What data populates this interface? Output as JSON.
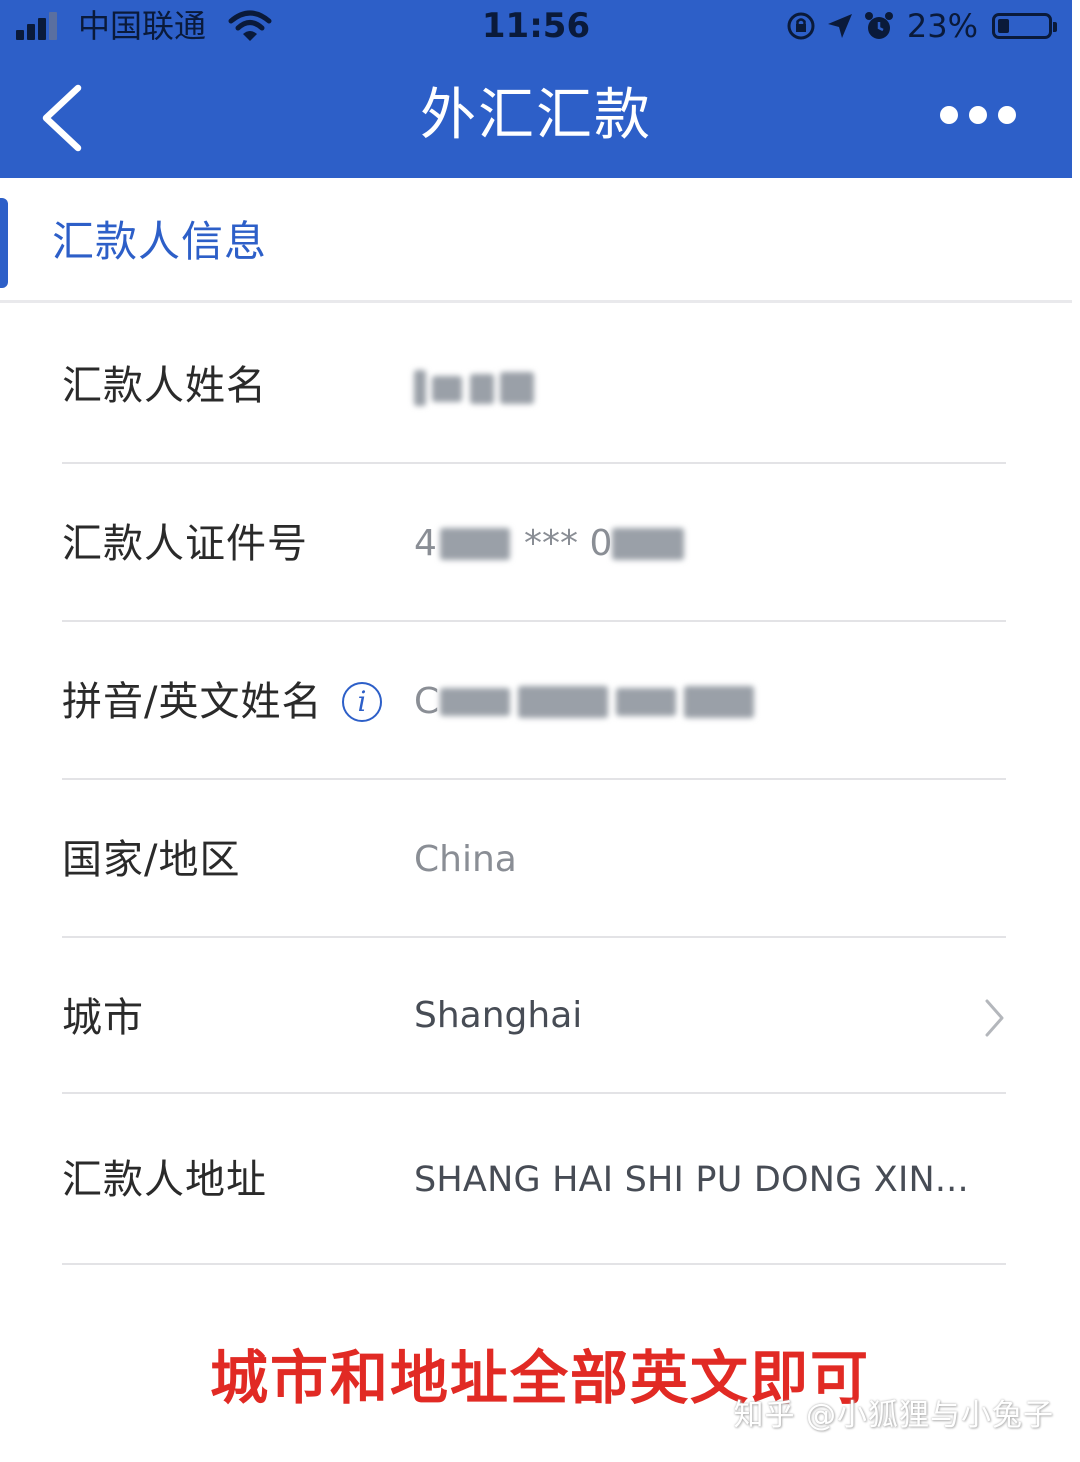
{
  "status_bar": {
    "carrier": "中国联通",
    "time": "11:56",
    "battery_percent": "23%",
    "battery_level": 0.23,
    "icons": [
      "signal-icon",
      "wifi-icon",
      "orientation-lock-icon",
      "location-arrow-icon",
      "alarm-icon",
      "battery-icon"
    ]
  },
  "nav": {
    "title": "外汇汇款",
    "back_icon": "back-chevron-icon",
    "more_icon": "more-dots-icon"
  },
  "section": {
    "title": "汇款人信息"
  },
  "form": {
    "rows": [
      {
        "label": "汇款人姓名",
        "value": ""
      },
      {
        "label": "汇款人证件号",
        "value_prefix": "4",
        "value_mask": "*** 0"
      },
      {
        "label": "拼音/英文姓名",
        "info_icon": "i",
        "value_prefix": "C"
      },
      {
        "label": "国家/地区",
        "value": "China"
      },
      {
        "label": "城市",
        "value": "Shanghai"
      },
      {
        "label": "汇款人地址",
        "value": "SHANG HAI SHI PU DONG XIN..."
      }
    ]
  },
  "annotation": "城市和地址全部英文即可",
  "watermark": "知乎 @小狐狸与小兔子",
  "colors": {
    "header_blue": "#2d5fc8",
    "annotation_red": "#e12a24"
  }
}
